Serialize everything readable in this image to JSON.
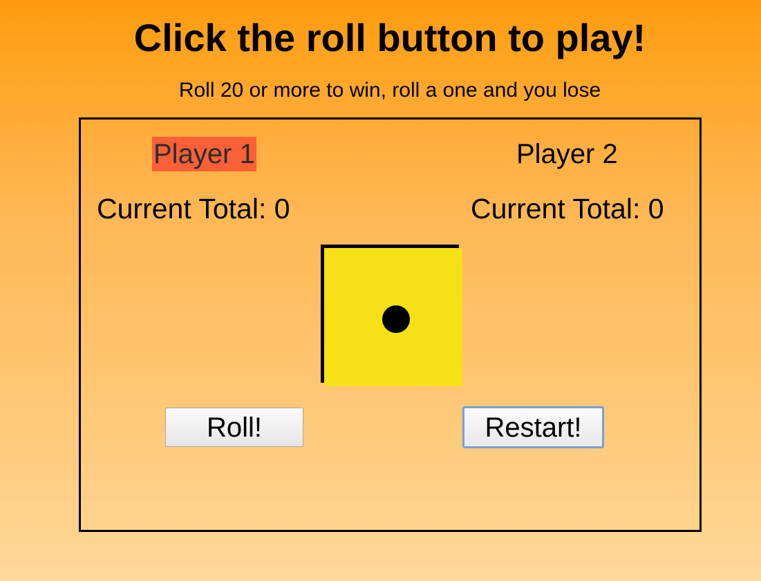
{
  "header": {
    "title": "Click the roll button to play!",
    "subtitle": "Roll 20 or more to win, roll a one and you lose"
  },
  "players": [
    {
      "name": "Player 1",
      "total_label": "Current Total: 0",
      "total": 0,
      "active": true
    },
    {
      "name": "Player 2",
      "total_label": "Current Total: 0",
      "total": 0,
      "active": false
    }
  ],
  "die": {
    "face_value": 1,
    "color": "#f5e116",
    "pip_color": "#000000"
  },
  "controls": {
    "roll_label": "Roll!",
    "restart_label": "Restart!"
  },
  "colors": {
    "active_player_highlight": "#fb6036",
    "background_top": "#ff9c0e",
    "background_bottom": "#ffd899",
    "focus_ring": "#7a9fd6"
  }
}
